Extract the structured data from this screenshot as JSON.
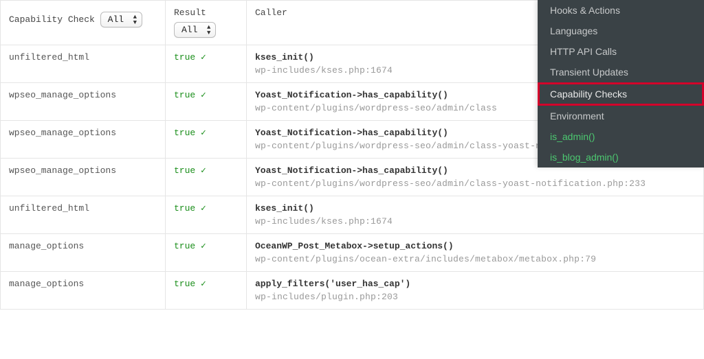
{
  "headers": {
    "capability": "Capability Check",
    "result": "Result",
    "caller": "Caller"
  },
  "filters": {
    "capability_value": "All",
    "result_value": "All"
  },
  "rows": [
    {
      "cap": "unfiltered_html",
      "res": "true ✓",
      "fn": "kses_init()",
      "path": "wp-includes/kses.php:1674"
    },
    {
      "cap": "wpseo_manage_options",
      "res": "true ✓",
      "fn": "Yoast_Notification->has_capability()",
      "path": "wp-content/plugins/wordpress-seo/admin/class"
    },
    {
      "cap": "wpseo_manage_options",
      "res": "true ✓",
      "fn": "Yoast_Notification->has_capability()",
      "path": "wp-content/plugins/wordpress-seo/admin/class-yoast-notification.php:233"
    },
    {
      "cap": "wpseo_manage_options",
      "res": "true ✓",
      "fn": "Yoast_Notification->has_capability()",
      "path": "wp-content/plugins/wordpress-seo/admin/class-yoast-notification.php:233"
    },
    {
      "cap": "unfiltered_html",
      "res": "true ✓",
      "fn": "kses_init()",
      "path": "wp-includes/kses.php:1674"
    },
    {
      "cap": "manage_options",
      "res": "true ✓",
      "fn": "OceanWP_Post_Metabox->setup_actions()",
      "path": "wp-content/plugins/ocean-extra/includes/metabox/metabox.php:79"
    },
    {
      "cap": "manage_options",
      "res": "true ✓",
      "fn": "apply_filters('user_has_cap')",
      "path": "wp-includes/plugin.php:203"
    }
  ],
  "panel": {
    "items": [
      {
        "label": "Hooks & Actions",
        "fn": false,
        "hi": false
      },
      {
        "label": "Languages",
        "fn": false,
        "hi": false
      },
      {
        "label": "HTTP API Calls",
        "fn": false,
        "hi": false
      },
      {
        "label": "Transient Updates",
        "fn": false,
        "hi": false
      },
      {
        "label": "Capability Checks",
        "fn": false,
        "hi": true
      },
      {
        "label": "Environment",
        "fn": false,
        "hi": false
      },
      {
        "label": "is_admin()",
        "fn": true,
        "hi": false
      },
      {
        "label": "is_blog_admin()",
        "fn": true,
        "hi": false
      }
    ]
  }
}
